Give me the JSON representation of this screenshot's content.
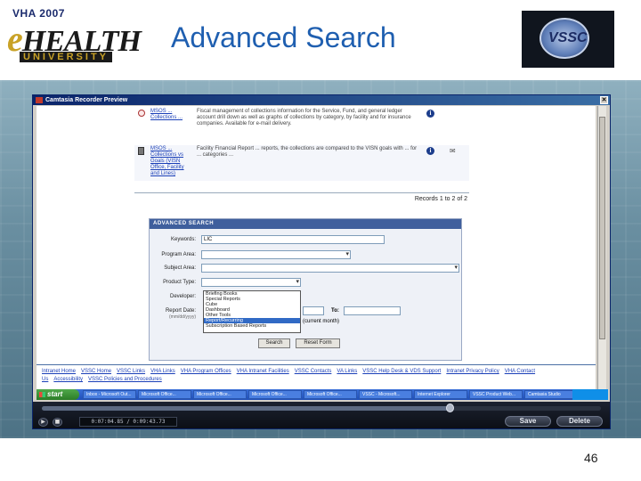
{
  "slide": {
    "title": "Advanced Search",
    "page_number": "46",
    "logo_left": {
      "top": "VHA 2007",
      "main_e": "e",
      "main_rest": "HEALTH",
      "bottom": "UNIVERSITY"
    },
    "logo_right": {
      "text": "VSSC"
    }
  },
  "recorder": {
    "window_title": "Camtasia Recorder Preview",
    "close_glyph": "✕"
  },
  "results": [
    {
      "link": "MSOS ... Collections ...",
      "desc": "Fiscal management of collections information for the Service, Fund, and general ledger account drill down as well as graphs of collections by category, by facility and for insurance companies. Available for e-mail delivery.",
      "icon": "report-icon"
    },
    {
      "link": "MSOS ... Collections vs Goals (VISN Office, Facility and Lines)",
      "desc": "Facility Financial Report ... reports, the collections are compared to the VISN goals with ... for ... categories ... ",
      "icon": "document-icon"
    }
  ],
  "records_text": "Records 1 to 2 of 2",
  "advanced_search": {
    "header": "ADVANCED SEARCH",
    "fields": {
      "keywords": {
        "label": "Keywords:",
        "value": "LIC"
      },
      "program_area": {
        "label": "Program Area:",
        "value": ""
      },
      "subject_area": {
        "label": "Subject Area:",
        "value": ""
      },
      "product_type": {
        "label": "Product Type:",
        "value": ""
      },
      "developer": {
        "label": "Developer:",
        "value": ""
      },
      "report_date": {
        "label": "Report Date:",
        "hint": "(mm/dd/yyyy)",
        "to_label": "To:",
        "suffix": "(current month)"
      }
    },
    "product_type_options": [
      "Briefing Books",
      "Special Reports",
      "Cube",
      "Dashboard",
      "Other Tools",
      "Report/Recurring",
      "Subscription Based Reports"
    ],
    "selected_option_index": 5,
    "buttons": {
      "search": "Search",
      "reset": "Reset Form"
    }
  },
  "footer_links": [
    "Intranet Home",
    "VSSC Home",
    "VSSC Links",
    "VHA Links",
    "VHA Program Offices",
    "VHA Intranet Facilities",
    "VSSC Contacts",
    "VA Links",
    "VSSC Help Desk & VDS Support",
    "Intranet Privacy Policy",
    "VHA Contact Us",
    "Accessibility",
    "VSSC Policies and Procedures"
  ],
  "taskbar": {
    "start": "start",
    "tasks": [
      "Inbox - Microsoft Out...",
      "Microsoft Office...",
      "Microsoft Office...",
      "Microsoft Office...",
      "Microsoft Office...",
      "VSSC - Microsoft...",
      "Internet Explorer",
      "VSSC Product Web...",
      "Camtasia Studio"
    ],
    "clock": ""
  },
  "player": {
    "timecode": "0:07:04.85 / 0:09:43.73",
    "play_glyph": "▶",
    "stop_glyph": "■",
    "seek_fraction": 0.73,
    "save": "Save",
    "delete": "Delete"
  }
}
